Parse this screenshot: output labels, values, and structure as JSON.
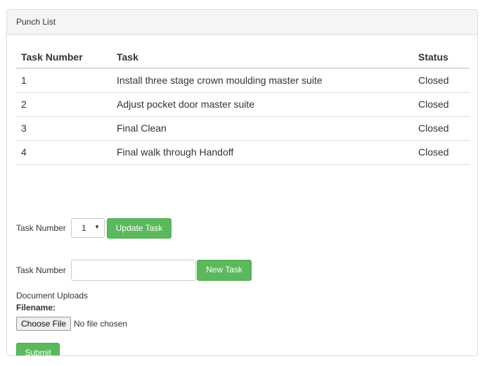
{
  "panel": {
    "title": "Punch List"
  },
  "table": {
    "headers": {
      "task_number": "Task Number",
      "task": "Task",
      "status": "Status"
    },
    "rows": [
      {
        "number": "1",
        "task": "Install three stage crown moulding master suite",
        "status": "Closed"
      },
      {
        "number": "2",
        "task": "Adjust pocket door master suite",
        "status": "Closed"
      },
      {
        "number": "3",
        "task": "Final Clean",
        "status": "Closed"
      },
      {
        "number": "4",
        "task": "Final walk through Handoff",
        "status": "Closed"
      }
    ]
  },
  "update_form": {
    "label": "Task Number",
    "selected_value": "1",
    "button_label": "Update Task"
  },
  "new_form": {
    "label": "Task Number",
    "input_value": "",
    "button_label": "New Task"
  },
  "uploads": {
    "section_label": "Document Uploads",
    "filename_label": "Filename:",
    "choose_file_label": "Choose File",
    "file_status": "No file chosen",
    "submit_label": "Submit"
  },
  "colors": {
    "button_green": "#5cb85c",
    "heading_bg": "#f5f5f5",
    "border": "#dddddd"
  }
}
